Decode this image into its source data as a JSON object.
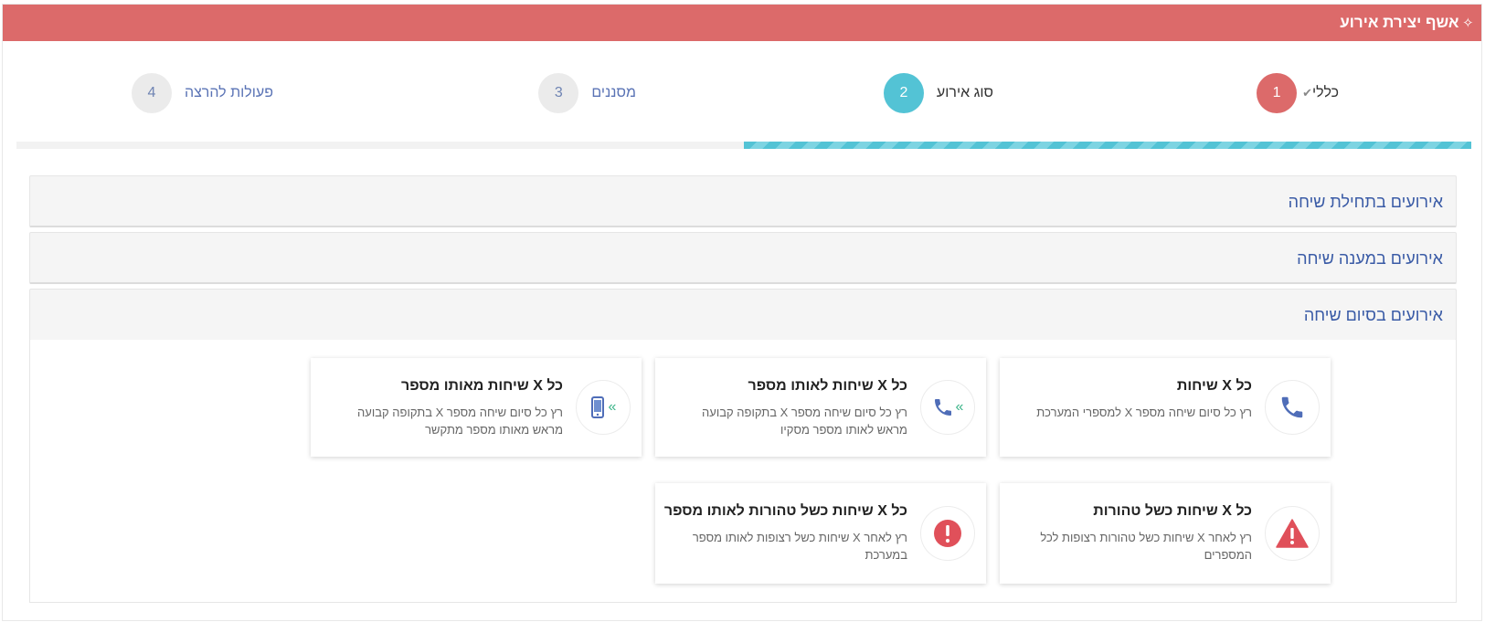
{
  "header": {
    "title": "אשף יצירת אירוע",
    "icon": "magic-wand-icon"
  },
  "wizard": {
    "steps": [
      {
        "number": "1",
        "label": "כללי",
        "state": "done"
      },
      {
        "number": "2",
        "label": "סוג אירוע",
        "state": "current"
      },
      {
        "number": "3",
        "label": "מסננים",
        "state": "upcoming"
      },
      {
        "number": "4",
        "label": "פעולות להרצה",
        "state": "upcoming"
      }
    ],
    "progress_fraction": 0.5
  },
  "panels": [
    {
      "title": "אירועים בתחילת שיחה",
      "expanded": false
    },
    {
      "title": "אירועים במענה שיחה",
      "expanded": false
    },
    {
      "title": "אירועים בסיום שיחה",
      "expanded": true
    }
  ],
  "cards": [
    {
      "title": "כל X שיחות",
      "desc": "רץ כל סיום שיחה מספר X למספרי המערכת",
      "icon": "phone-icon"
    },
    {
      "title": "כל X שיחות לאותו מספר",
      "desc": "רץ כל סיום שיחה מספר X בתקופה קבועה מראש לאותו מספר מסקיו",
      "icon": "phone-forward-icon"
    },
    {
      "title": "כל X שיחות מאותו מספר",
      "desc": "רץ כל סיום שיחה מספר X בתקופה קבועה מראש מאותו מספר מתקשר",
      "icon": "mobile-forward-icon"
    },
    {
      "title": "כל X שיחות כשל טהורות",
      "desc": "רץ לאחר X שיחות כשל טהורות רצופות לכל המספרים",
      "icon": "warning-triangle-icon"
    },
    {
      "title": "כל X שיחות כשל טהורות לאותו מספר",
      "desc": "רץ לאחר X שיחות כשל רצופות לאותו מספר במערכת",
      "icon": "exclamation-circle-icon"
    }
  ],
  "colors": {
    "header": "#dc6a6a",
    "current_step": "#53c3d5",
    "link": "#3a5ba6",
    "danger": "#e0505a",
    "phone": "#4f6db8"
  }
}
